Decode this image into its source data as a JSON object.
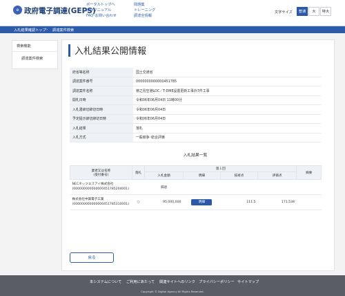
{
  "header": {
    "logo_mark": "e",
    "logo_text": "政府電子調達(GEPS)",
    "links_col1": [
      "ポータルトップへ",
      "操作マニュアル",
      "FAQ･お問い合わせ"
    ],
    "links_col2": [
      "問題集",
      "トレーニング",
      "調達全情報"
    ],
    "font_size_label": "文字サイズ",
    "font_sizes": [
      "普通",
      "大",
      "特大"
    ],
    "active_font_size": "普通"
  },
  "breadcrumb": [
    "入札結果確認トップ",
    "調達案件検索"
  ],
  "sidebar": {
    "heading": "検索機能",
    "item": "調達案件検索"
  },
  "page_title": "入札結果公開情報",
  "info": [
    {
      "label": "府省等名称",
      "value": "国土交通省"
    },
    {
      "label": "調達案件番号",
      "value": "0000000000000451785"
    },
    {
      "label": "調達案件名称",
      "value": "徳之島空港LOC／T-DME設置更新工事外7件工事"
    },
    {
      "label": "開札日時",
      "value": "令和06年06月04日 11時00分"
    },
    {
      "label": "入札書締切締切日時",
      "value": "令和06年06月04日"
    },
    {
      "label": "予定提示締切締切日時",
      "value": "令和06年06月04日"
    },
    {
      "label": "入札結果",
      "value": "落札"
    },
    {
      "label": "入札方式",
      "value": "一般競争･総合評価"
    }
  ],
  "results": {
    "title": "入札結果一覧",
    "headers": {
      "company": "業者又は名称",
      "company_sub": "(受付番号)",
      "award": "落札",
      "round": "第１回",
      "amount": "入札金額",
      "detail": "明細",
      "technical": "技術点",
      "evaluation": "評価点",
      "remarks": "摘要"
    },
    "rows": [
      {
        "company": "NECネッツエスアイ株式会社",
        "receipt": "(000000000000000451785204001)",
        "award": "",
        "amount": "辞退",
        "detail": "",
        "technical": "",
        "evaluation": "",
        "remarks": ""
      },
      {
        "company": "株式会社中興電子工業",
        "receipt": "(000000000000000451785310001)",
        "award": "○",
        "amount": "95,000,000",
        "detail": "明細",
        "technical": "111.5",
        "evaluation": "171.538",
        "remarks": ""
      }
    ]
  },
  "back_label": "戻る",
  "footer": {
    "links": [
      "本システムについて",
      "ご利用にあたって",
      "関連サイトへのリンク",
      "プライバシーポリシー",
      "サイトマップ"
    ],
    "copyright": "Copyright © Digital Agency All Rights Reserved."
  },
  "colors": {
    "primary": "#2b58a8",
    "footer": "#5a5d63",
    "label_bg": "#eef1f6"
  }
}
